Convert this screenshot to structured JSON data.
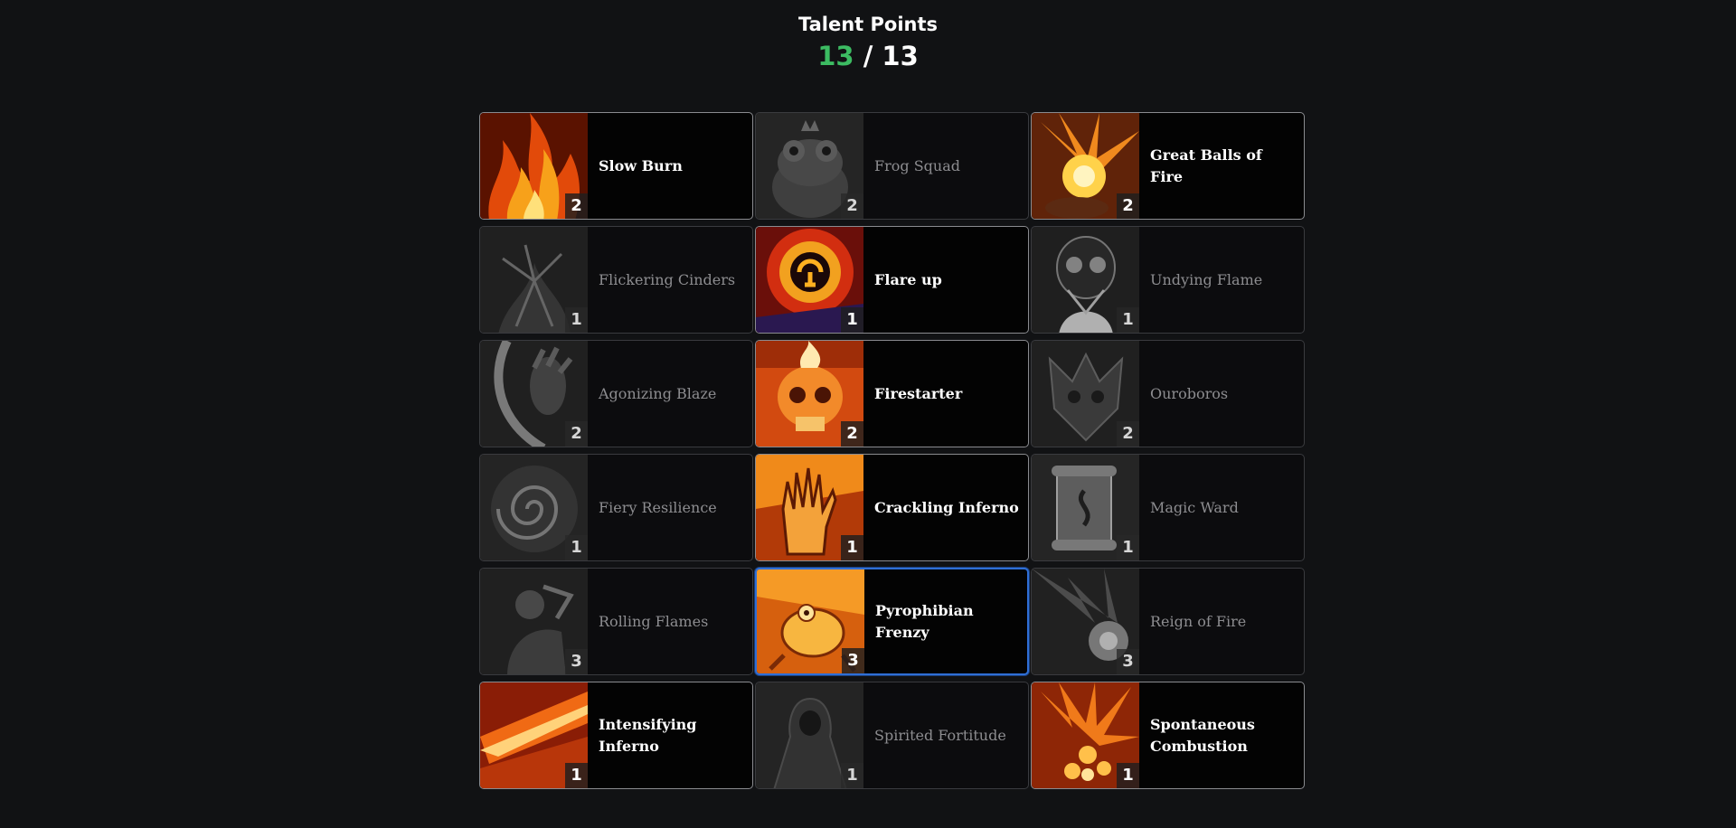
{
  "header": {
    "title": "Talent Points",
    "points_used": "13",
    "points_separator": "/",
    "points_total": "13"
  },
  "talents": [
    {
      "name": "Slow Burn",
      "rank": "2",
      "active": true,
      "icon": "flame-icon"
    },
    {
      "name": "Frog Squad",
      "rank": "2",
      "active": false,
      "icon": "frog-king-icon"
    },
    {
      "name": "Great Balls of Fire",
      "rank": "2",
      "active": true,
      "icon": "fireball-icon"
    },
    {
      "name": "Flickering Cinders",
      "rank": "1",
      "active": false,
      "icon": "cinders-icon"
    },
    {
      "name": "Flare up",
      "rank": "1",
      "active": true,
      "icon": "flare-rune-icon"
    },
    {
      "name": "Undying Flame",
      "rank": "1",
      "active": false,
      "icon": "skull-spirit-icon"
    },
    {
      "name": "Agonizing Blaze",
      "rank": "2",
      "active": false,
      "icon": "claw-icon"
    },
    {
      "name": "Firestarter",
      "rank": "2",
      "active": true,
      "icon": "flaming-skull-icon"
    },
    {
      "name": "Ouroboros",
      "rank": "2",
      "active": false,
      "icon": "dragon-skull-icon"
    },
    {
      "name": "Fiery Resilience",
      "rank": "1",
      "active": false,
      "icon": "swirl-icon"
    },
    {
      "name": "Crackling Inferno",
      "rank": "1",
      "active": true,
      "icon": "burning-hand-icon"
    },
    {
      "name": "Magic Ward",
      "rank": "1",
      "active": false,
      "icon": "scroll-icon"
    },
    {
      "name": "Rolling Flames",
      "rank": "3",
      "active": false,
      "icon": "rolling-figure-icon"
    },
    {
      "name": "Pyrophibian Frenzy",
      "rank": "3",
      "active": true,
      "selected": true,
      "icon": "fire-frog-icon"
    },
    {
      "name": "Reign of Fire",
      "rank": "3",
      "active": false,
      "icon": "meteor-icon"
    },
    {
      "name": "Intensifying Inferno",
      "rank": "1",
      "active": true,
      "icon": "fire-streak-icon"
    },
    {
      "name": "Spirited Fortitude",
      "rank": "1",
      "active": false,
      "icon": "hooded-figure-icon"
    },
    {
      "name": "Spontaneous Combustion",
      "rank": "1",
      "active": true,
      "icon": "explosion-icon"
    }
  ],
  "colors": {
    "background": "#111214",
    "points_used": "#3cbb62",
    "selected_border": "#2f6fd6"
  }
}
